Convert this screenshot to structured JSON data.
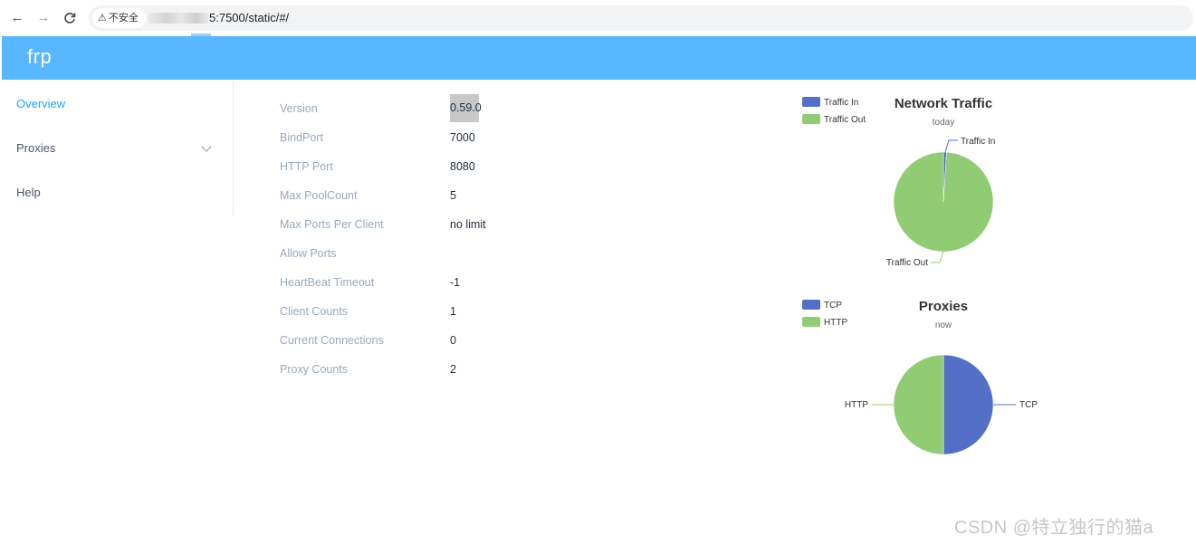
{
  "browser": {
    "back_icon": "arrow-left-icon",
    "forward_icon": "arrow-right-icon",
    "reload_icon": "reload-icon",
    "security_label": "不安全",
    "url_suffix": "5:7500/static/#/"
  },
  "header": {
    "brand": "frp",
    "color": "#58b7ff"
  },
  "sidebar": {
    "items": [
      {
        "label": "Overview",
        "active": true
      },
      {
        "label": "Proxies",
        "active": false
      },
      {
        "label": "Help",
        "active": false
      }
    ]
  },
  "overview": {
    "rows": [
      {
        "label": "Version",
        "value": "0.59.0"
      },
      {
        "label": "BindPort",
        "value": "7000"
      },
      {
        "label": "HTTP Port",
        "value": "8080"
      },
      {
        "label": "Max PoolCount",
        "value": "5"
      },
      {
        "label": "Max Ports Per Client",
        "value": "no limit"
      },
      {
        "label": "Allow Ports",
        "value": ""
      },
      {
        "label": "HeartBeat Timeout",
        "value": "-1"
      },
      {
        "label": "Client Counts",
        "value": "1"
      },
      {
        "label": "Current Connections",
        "value": "0"
      },
      {
        "label": "Proxy Counts",
        "value": "2"
      }
    ]
  },
  "chart_data": [
    {
      "type": "pie",
      "title": "Network Traffic",
      "subtitle": "today",
      "legend": "top-left",
      "series": [
        {
          "name": "Traffic In",
          "value": 1,
          "color": "#5470c6"
        },
        {
          "name": "Traffic Out",
          "value": 99,
          "color": "#91cc75"
        }
      ]
    },
    {
      "type": "pie",
      "title": "Proxies",
      "subtitle": "now",
      "legend": "top-left",
      "series": [
        {
          "name": "TCP",
          "value": 1,
          "color": "#5470c6"
        },
        {
          "name": "HTTP",
          "value": 1,
          "color": "#91cc75"
        }
      ]
    }
  ],
  "watermark": "CSDN @特立独行的猫a"
}
